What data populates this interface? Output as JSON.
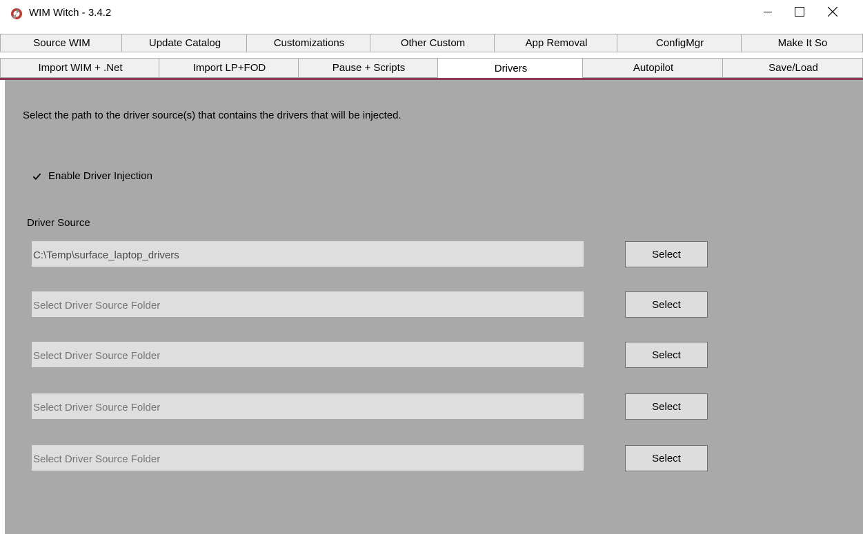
{
  "window": {
    "title": "WIM Witch - 3.4.2"
  },
  "tabs": {
    "row1": [
      {
        "label": "Source WIM"
      },
      {
        "label": "Update Catalog"
      },
      {
        "label": "Customizations"
      },
      {
        "label": "Other Custom"
      },
      {
        "label": "App Removal"
      },
      {
        "label": "ConfigMgr"
      },
      {
        "label": "Make It So"
      }
    ],
    "row2": [
      {
        "label": "Import WIM + .Net"
      },
      {
        "label": "Import LP+FOD"
      },
      {
        "label": "Pause + Scripts"
      },
      {
        "label": "Drivers"
      },
      {
        "label": "Autopilot"
      },
      {
        "label": "Save/Load"
      }
    ],
    "selected": "Drivers"
  },
  "drivers": {
    "instructions": "Select the path to the driver source(s) that contains the drivers that will be injected.",
    "enable_checkbox": {
      "label": "Enable Driver Injection",
      "checked": true
    },
    "section_label": "Driver Source",
    "sources": [
      {
        "value": "C:\\Temp\\surface_laptop_drivers",
        "placeholder": "",
        "button": "Select"
      },
      {
        "value": "",
        "placeholder": "Select Driver Source Folder",
        "button": "Select"
      },
      {
        "value": "",
        "placeholder": "Select Driver Source Folder",
        "button": "Select"
      },
      {
        "value": "",
        "placeholder": "Select Driver Source Folder",
        "button": "Select"
      },
      {
        "value": "",
        "placeholder": "Select Driver Source Folder",
        "button": "Select"
      }
    ]
  },
  "colors": {
    "panel_background": "#a9a9a9",
    "tab_accent": "#8b3a52",
    "field_background": "#dedede"
  },
  "icons": {
    "app": "wim-witch-logo-icon",
    "minimize": "minimize-icon",
    "maximize": "maximize-icon",
    "close": "close-icon",
    "checkmark": "checkmark-icon"
  }
}
